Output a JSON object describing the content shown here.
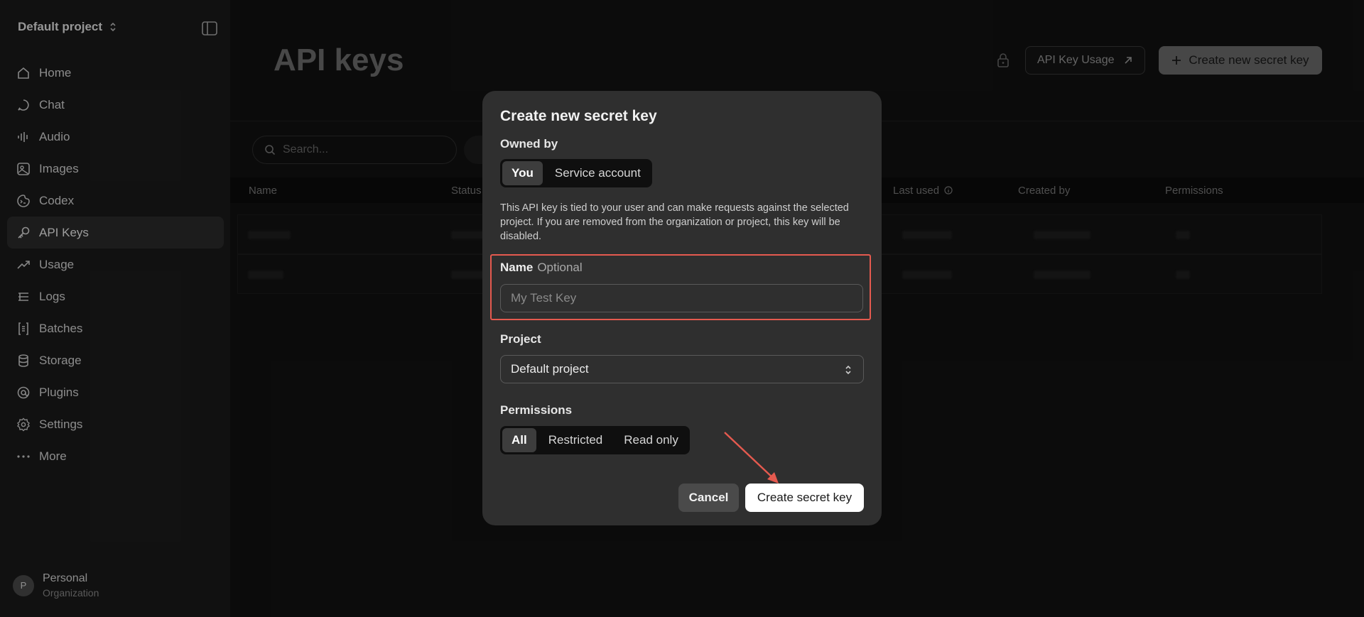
{
  "sidebar": {
    "project": "Default project",
    "items": [
      {
        "label": "Home",
        "icon": "home-icon"
      },
      {
        "label": "Chat",
        "icon": "chat-icon"
      },
      {
        "label": "Audio",
        "icon": "audio-icon"
      },
      {
        "label": "Images",
        "icon": "image-icon"
      },
      {
        "label": "Codex",
        "icon": "codex-icon"
      },
      {
        "label": "API Keys",
        "icon": "key-icon",
        "active": true
      },
      {
        "label": "Usage",
        "icon": "usage-icon"
      },
      {
        "label": "Logs",
        "icon": "logs-icon"
      },
      {
        "label": "Batches",
        "icon": "batches-icon"
      },
      {
        "label": "Storage",
        "icon": "storage-icon"
      },
      {
        "label": "Plugins",
        "icon": "plugins-icon"
      },
      {
        "label": "Settings",
        "icon": "gear-icon"
      },
      {
        "label": "More",
        "icon": "more-icon"
      }
    ],
    "account": {
      "initial": "P",
      "name": "Personal",
      "type": "Organization"
    }
  },
  "main": {
    "title": "API keys",
    "usage_button": "API Key Usage",
    "create_button": "Create new secret key",
    "search_placeholder": "Search...",
    "columns": {
      "name": "Name",
      "status": "Status",
      "last_used": "Last used",
      "created_by": "Created by",
      "permissions": "Permissions"
    }
  },
  "modal": {
    "title": "Create new secret key",
    "owned_by_label": "Owned by",
    "owner_options": [
      "You",
      "Service account"
    ],
    "owner_selected": "You",
    "description": "This API key is tied to your user and can make requests against the selected project. If you are removed from the organization or project, this key will be disabled.",
    "name_label": "Name",
    "name_optional": "Optional",
    "name_placeholder": "My Test Key",
    "project_label": "Project",
    "project_value": "Default project",
    "permissions_label": "Permissions",
    "permission_options": [
      "All",
      "Restricted",
      "Read only"
    ],
    "permission_selected": "All",
    "cancel": "Cancel",
    "submit": "Create secret key"
  },
  "colors": {
    "highlight": "#e55a4f",
    "background": "#121212",
    "modal": "#2f2f2f"
  }
}
